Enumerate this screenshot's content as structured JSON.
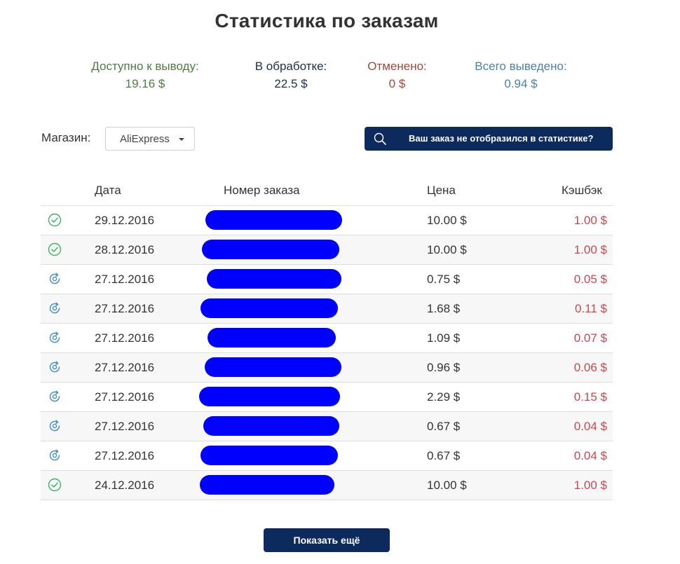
{
  "page": {
    "title": "Статистика по заказам"
  },
  "summary": {
    "available": {
      "label": "Доступно к выводу:",
      "value": "19.16 $",
      "color": "#4e7d42"
    },
    "processing": {
      "label": "В обработке:",
      "value": "22.5 $",
      "color": "#1e2d4a"
    },
    "cancelled": {
      "label": "Отменено:",
      "value": "0 $",
      "color": "#a2483b"
    },
    "withdrawn": {
      "label": "Всего выведено:",
      "value": "0.94 $",
      "color": "#4c80ad"
    }
  },
  "filter": {
    "shop_label": "Магазин:",
    "shop_value": "AliExpress",
    "missing_order_button": "Ваш заказ не отобразился в статистике?",
    "search_icon": "search-icon"
  },
  "table": {
    "headers": {
      "date": "Дата",
      "order": "Номер заказа",
      "price": "Цена",
      "cashback": "Кэшбэк"
    },
    "rows": [
      {
        "status": "check-icon",
        "date": "29.12.2016",
        "price": "10.00 $",
        "cashback": "1.00 $"
      },
      {
        "status": "check-icon",
        "date": "28.12.2016",
        "price": "10.00 $",
        "cashback": "1.00 $"
      },
      {
        "status": "refresh-icon",
        "date": "27.12.2016",
        "price": "0.75 $",
        "cashback": "0.05 $"
      },
      {
        "status": "refresh-icon",
        "date": "27.12.2016",
        "price": "1.68 $",
        "cashback": "0.11 $"
      },
      {
        "status": "refresh-icon",
        "date": "27.12.2016",
        "price": "1.09 $",
        "cashback": "0.07 $"
      },
      {
        "status": "refresh-icon",
        "date": "27.12.2016",
        "price": "0.96 $",
        "cashback": "0.06 $"
      },
      {
        "status": "refresh-icon",
        "date": "27.12.2016",
        "price": "2.29 $",
        "cashback": "0.15 $"
      },
      {
        "status": "refresh-icon",
        "date": "27.12.2016",
        "price": "0.67 $",
        "cashback": "0.04 $"
      },
      {
        "status": "refresh-icon",
        "date": "27.12.2016",
        "price": "0.67 $",
        "cashback": "0.04 $"
      },
      {
        "status": "check-icon",
        "date": "24.12.2016",
        "price": "10.00 $",
        "cashback": "1.00 $"
      }
    ]
  },
  "more_button": "Показать ещё",
  "colors": {
    "brand": "#0d2a5c",
    "cashback": "#d0464e",
    "check": "#3cb36a",
    "refresh": "#4a90c8",
    "redaction": "#0000ff"
  }
}
